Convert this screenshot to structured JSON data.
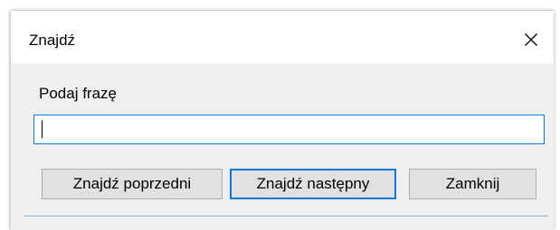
{
  "window": {
    "title": "Znajdź",
    "close_icon": "close-icon"
  },
  "form": {
    "prompt_label": "Podaj frazę",
    "search_value": "",
    "search_placeholder": ""
  },
  "buttons": {
    "find_previous": "Znajdź poprzedni",
    "find_next": "Znajdź następny",
    "close": "Zamknij"
  },
  "colors": {
    "accent": "#0a78d7",
    "dialog_background": "#f0f0f0",
    "button_background": "#e1e1e1"
  }
}
